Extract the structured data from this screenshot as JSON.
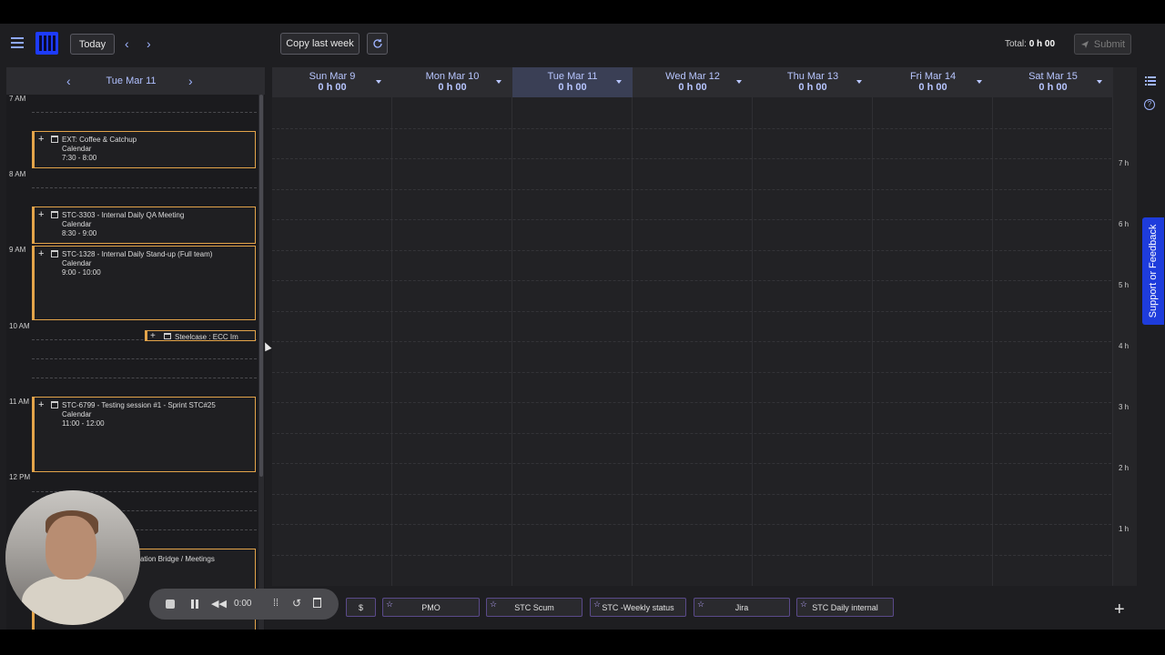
{
  "toolbar": {
    "today_label": "Today",
    "copy_last_week_label": "Copy last week",
    "total_label": "Total:",
    "total_value": "0 h 00",
    "submit_label": "Submit"
  },
  "day_panel": {
    "title": "Tue Mar 11",
    "time_labels": [
      "7 AM",
      "8 AM",
      "9 AM",
      "10 AM",
      "11 AM",
      "12 PM"
    ],
    "events": [
      {
        "title": "EXT: Coffee & Catchup",
        "source": "Calendar",
        "time": "7:30 - 8:00"
      },
      {
        "title": "STC-3303 - Internal Daily QA Meeting",
        "source": "Calendar",
        "time": "8:30 - 9:00"
      },
      {
        "title": "STC-1328 - Internal Daily Stand-up (Full team)",
        "source": "Calendar",
        "time": "9:00 - 10:00"
      },
      {
        "title": "STC-6799 - Testing session #1 - Sprint STC#25",
        "source": "Calendar",
        "time": "11:00 - 12:00"
      },
      {
        "title": "ation Bridge / Meetings",
        "source": "",
        "time": ""
      }
    ],
    "dragging_event_label": "Steelcase : ECC Im"
  },
  "week": {
    "days": [
      {
        "name": "Sun Mar 9",
        "hours": "0 h 00",
        "active": false
      },
      {
        "name": "Mon Mar 10",
        "hours": "0 h 00",
        "active": false
      },
      {
        "name": "Tue Mar 11",
        "hours": "0 h 00",
        "active": true
      },
      {
        "name": "Wed Mar 12",
        "hours": "0 h 00",
        "active": false
      },
      {
        "name": "Thu Mar 13",
        "hours": "0 h 00",
        "active": false
      },
      {
        "name": "Fri Mar 14",
        "hours": "0 h 00",
        "active": false
      },
      {
        "name": "Sat Mar 15",
        "hours": "0 h 00",
        "active": false
      }
    ],
    "hour_axis": [
      "7 h",
      "6 h",
      "5 h",
      "4 h",
      "3 h",
      "2 h",
      "1 h"
    ]
  },
  "side": {
    "feedback_label": "Support or Feedback"
  },
  "favorites": [
    {
      "label": "$"
    },
    {
      "label": "PMO"
    },
    {
      "label": "STC Scum"
    },
    {
      "label": "STC -Weekly status"
    },
    {
      "label": "Jira"
    },
    {
      "label": "STC Daily internal"
    }
  ],
  "recorder": {
    "time": "0:00"
  },
  "colors": {
    "accent": "#9fb4ff",
    "event_border": "#e3a44a",
    "logo": "#1d3bff",
    "feedback_bg": "#1e3cdc"
  }
}
